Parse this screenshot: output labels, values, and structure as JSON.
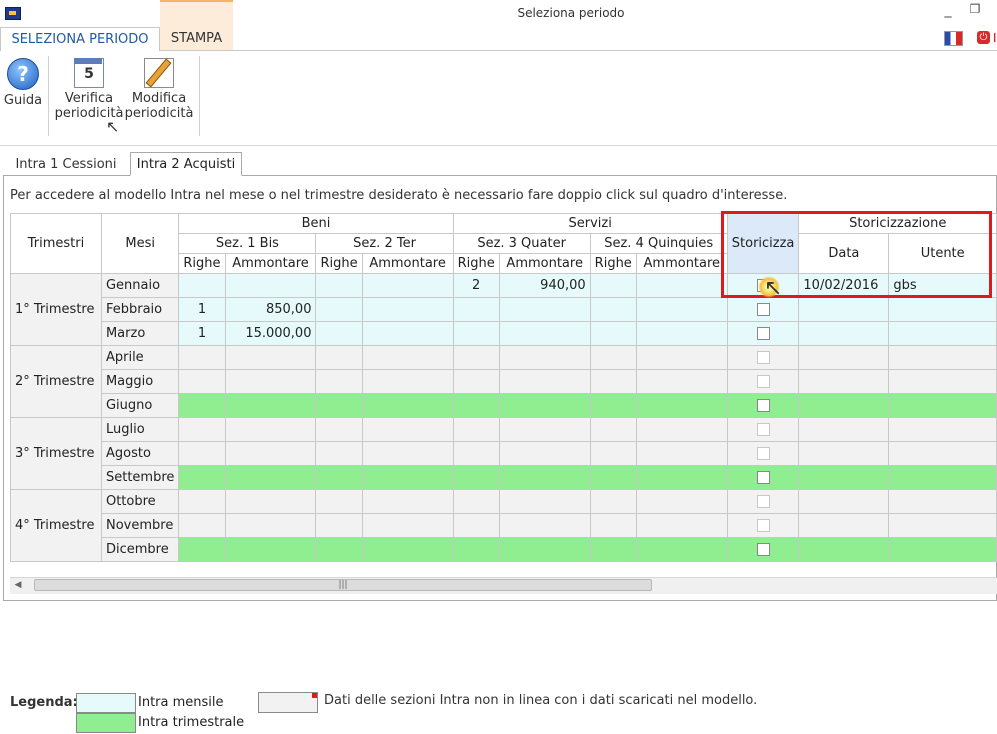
{
  "window": {
    "title": "Seleziona periodo",
    "minimize": "_",
    "restore": "❐"
  },
  "ribbon": {
    "tabs": [
      "SELEZIONA PERIODO",
      "STAMPA"
    ],
    "power_label": "I",
    "buttons": {
      "guida": "Guida",
      "verifica_1": "Verifica",
      "verifica_2": "periodicità",
      "modifica_1": "Modifica",
      "modifica_2": "periodicità",
      "cal_num": "5"
    }
  },
  "tabs": [
    "Intra 1 Cessioni",
    "Intra 2 Acquisti"
  ],
  "instruction": "Per accedere al modello Intra nel mese o nel trimestre desiderato è necessario fare doppio click sul quadro d'interesse.",
  "grid": {
    "headers": {
      "trimestri": "Trimestri",
      "mesi": "Mesi",
      "beni": "Beni",
      "servizi": "Servizi",
      "storicizza": "Storicizza",
      "storicizzazione": "Storicizzazione",
      "sez1": "Sez. 1 Bis",
      "sez2": "Sez. 2 Ter",
      "sez3": "Sez. 3 Quater",
      "sez4": "Sez. 4 Quinquies",
      "righe": "Righe",
      "ammontare": "Ammontare",
      "data": "Data",
      "utente": "Utente"
    },
    "quarters": [
      "1° Trimestre",
      "2° Trimestre",
      "3° Trimestre",
      "4° Trimestre"
    ],
    "rows": [
      {
        "mese": "Gennaio",
        "s1r": "",
        "s1a": "",
        "s3r": "2",
        "s3a": "940,00",
        "checked": true,
        "data": "10/02/2016",
        "utente": "gbs"
      },
      {
        "mese": "Febbraio",
        "s1r": "1",
        "s1a": "850,00",
        "s3r": "",
        "s3a": "",
        "checked": false,
        "data": "",
        "utente": ""
      },
      {
        "mese": "Marzo",
        "s1r": "1",
        "s1a": "15.000,00",
        "s3r": "",
        "s3a": "",
        "checked": false,
        "data": "",
        "utente": ""
      },
      {
        "mese": "Aprile"
      },
      {
        "mese": "Maggio"
      },
      {
        "mese": "Giugno"
      },
      {
        "mese": "Luglio"
      },
      {
        "mese": "Agosto"
      },
      {
        "mese": "Settembre"
      },
      {
        "mese": "Ottobre"
      },
      {
        "mese": "Novembre"
      },
      {
        "mese": "Dicembre"
      }
    ],
    "check_mark": "✓"
  },
  "legend": {
    "title": "Legenda:",
    "mensile": "Intra mensile",
    "trimestrale": "Intra trimestrale",
    "non_in_linea": "Dati delle sezioni Intra non in linea con i dati scaricati nel modello."
  },
  "colors": {
    "mensile": "#e6fafb",
    "trimestrale": "#90ee90",
    "highlight": "#e01a1a"
  }
}
